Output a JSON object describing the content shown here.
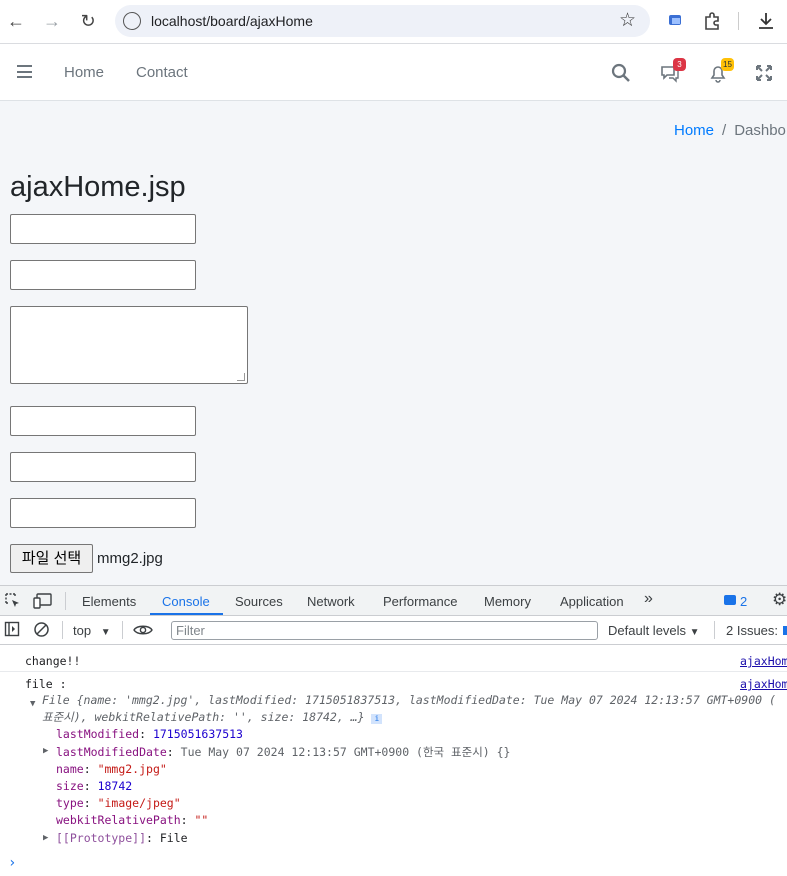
{
  "browser": {
    "url": "localhost/board/ajaxHome"
  },
  "navbar": {
    "links": [
      "Home",
      "Contact"
    ],
    "messages_badge": "3",
    "notifications_badge": "15"
  },
  "breadcrumb": {
    "home": "Home",
    "separator": "/",
    "current": "Dashbo"
  },
  "page": {
    "title": "ajaxHome.jsp",
    "file_button_label": "파일 선택",
    "file_name": "mmg2.jpg"
  },
  "devtools": {
    "tabs": [
      "Elements",
      "Console",
      "Sources",
      "Network",
      "Performance",
      "Memory",
      "Application"
    ],
    "active_tab": "Console",
    "messages_count": "2",
    "context": "top",
    "filter_placeholder": "Filter",
    "levels": "Default levels",
    "issues": "2 Issues:",
    "console": {
      "line1": "change!!",
      "line1_source": "ajaxHom",
      "line2": "file :",
      "line2_source": "ajaxHom",
      "file_summary_a": "File {name: 'mmg2.jpg', lastModified: 1715051837513, lastModifiedDate: Tue May 07 2024 12:13:57 GMT+0900 (",
      "file_summary_b": "표준시), webkitRelativePath: '', size: 18742, …}",
      "props": [
        {
          "key": "lastModified",
          "value": "1715051637513",
          "kind": "num"
        },
        {
          "key": "lastModifiedDate",
          "value": "Tue May 07 2024 12:13:57 GMT+0900 (한국 표준시) {}",
          "kind": "plain"
        },
        {
          "key": "name",
          "value": "\"mmg2.jpg\"",
          "kind": "str"
        },
        {
          "key": "size",
          "value": "18742",
          "kind": "num"
        },
        {
          "key": "type",
          "value": "\"image/jpeg\"",
          "kind": "str"
        },
        {
          "key": "webkitRelativePath",
          "value": "\"\"",
          "kind": "str"
        },
        {
          "key": "[[Prototype]]",
          "value": "File",
          "kind": "plain"
        }
      ]
    }
  }
}
